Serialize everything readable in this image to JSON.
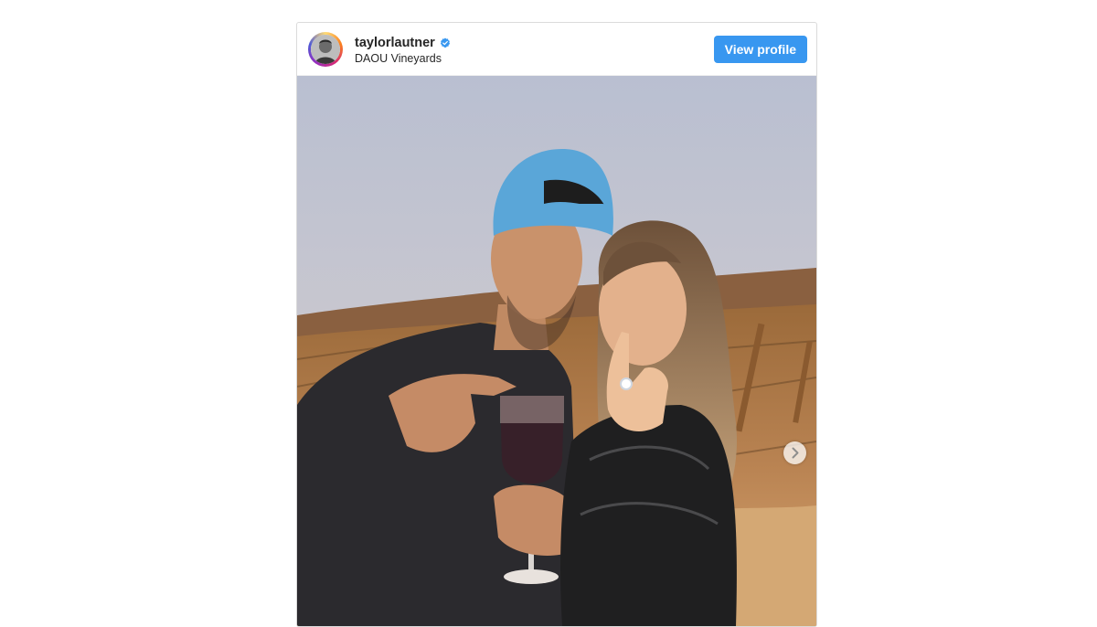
{
  "post": {
    "username": "taylorlautner",
    "location": "DAOU Vineyards",
    "view_profile_label": "View profile",
    "verified": true
  },
  "icons": {
    "verified": "verified-badge-icon",
    "next": "chevron-right-icon"
  },
  "colors": {
    "button": "#3897f0",
    "verified": "#3897f0",
    "text": "#262626"
  }
}
